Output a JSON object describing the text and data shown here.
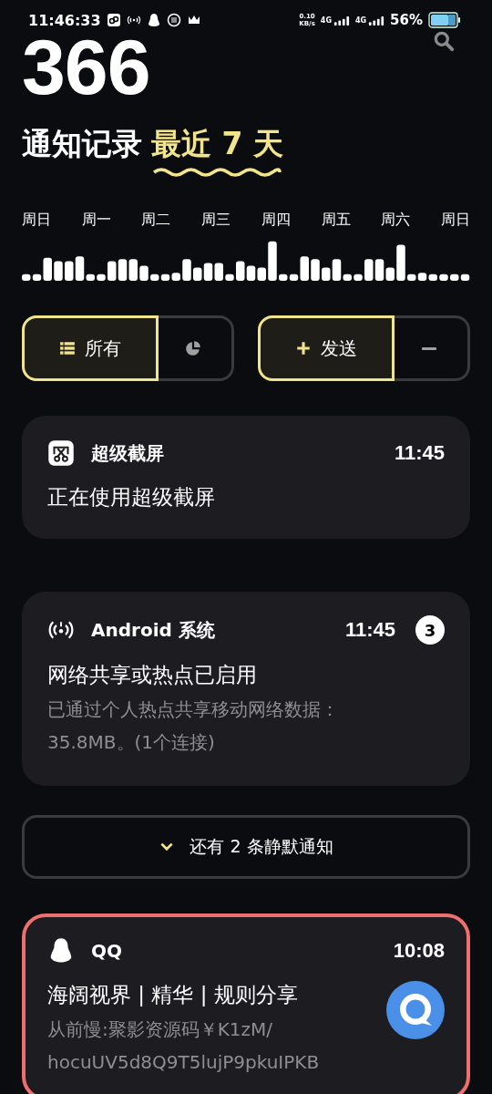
{
  "status_bar": {
    "time": "11:46:33",
    "speed": "0.10",
    "speed_unit": "KB/s",
    "signals": [
      "4G",
      "4G"
    ],
    "battery": "56%"
  },
  "header": {
    "count": "366",
    "title": "通知记录",
    "range": "最近 7 天"
  },
  "week_labels": [
    "周日",
    "周一",
    "周二",
    "周三",
    "周四",
    "周五",
    "周六",
    "周日"
  ],
  "filters": [
    {
      "kind": "list",
      "label": "所有",
      "selected": true
    },
    {
      "kind": "chart",
      "selected": false
    }
  ],
  "actions": [
    {
      "kind": "send",
      "label": "发送",
      "selected": true
    },
    {
      "kind": "minus",
      "selected": false
    }
  ],
  "notifications": [
    {
      "kind": "screenshot",
      "app": "超级截屏",
      "time": "11:45",
      "title": "正在使用超级截屏",
      "highlighted": false
    },
    {
      "kind": "hotspot",
      "app": "Android 系统",
      "time": "11:45",
      "badge": "3",
      "title": "网络共享或热点已启用",
      "body": "已通过个人热点共享移动网络数据：35.8MB。(1个连接)",
      "highlighted": false
    },
    {
      "kind": "silent",
      "label": "还有 2 条静默通知"
    },
    {
      "kind": "qq",
      "app": "QQ",
      "time": "10:08",
      "title": "海阔视界 | 精华 | 规则分享",
      "body": "从前慢:聚影资源码￥K1zM/ hocuUV5d8Q9T5lujP9pkuIPKB",
      "highlighted": true
    }
  ]
}
